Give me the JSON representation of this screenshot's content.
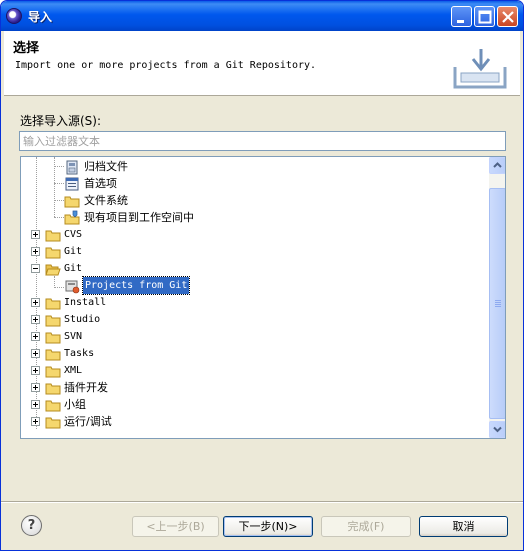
{
  "window": {
    "title": "导入"
  },
  "header": {
    "title": "选择",
    "description": "Import one or more projects from a Git Repository."
  },
  "source": {
    "label": "选择导入源(S):",
    "filter_placeholder": "输入过滤器文本"
  },
  "tree": {
    "items": [
      {
        "label": "归档文件",
        "icon": "archive-icon"
      },
      {
        "label": "首选项",
        "icon": "preferences-icon"
      },
      {
        "label": "文件系统",
        "icon": "folder-icon"
      },
      {
        "label": "现有项目到工作空间中",
        "icon": "project-folder-icon"
      },
      {
        "label": "CVS",
        "icon": "folder-icon"
      },
      {
        "label": "Git",
        "icon": "folder-icon"
      },
      {
        "label": "Git",
        "icon": "folder-icon"
      },
      {
        "label": "Projects from Git",
        "icon": "git-repository-icon"
      },
      {
        "label": "Install",
        "icon": "folder-icon"
      },
      {
        "label": "Studio",
        "icon": "folder-icon"
      },
      {
        "label": "SVN",
        "icon": "folder-icon"
      },
      {
        "label": "Tasks",
        "icon": "folder-icon"
      },
      {
        "label": "XML",
        "icon": "folder-icon"
      },
      {
        "label": "插件开发",
        "icon": "folder-icon"
      },
      {
        "label": "小组",
        "icon": "folder-icon"
      },
      {
        "label": "运行/调试",
        "icon": "folder-icon"
      }
    ]
  },
  "buttons": {
    "help": "?",
    "back": "<上一步(B)",
    "next": "下一步(N)>",
    "finish": "完成(F)",
    "cancel": "取消"
  },
  "colors": {
    "selection": "#316ac5",
    "titlebar": "#0058ee",
    "folder": "#f5d76e"
  }
}
